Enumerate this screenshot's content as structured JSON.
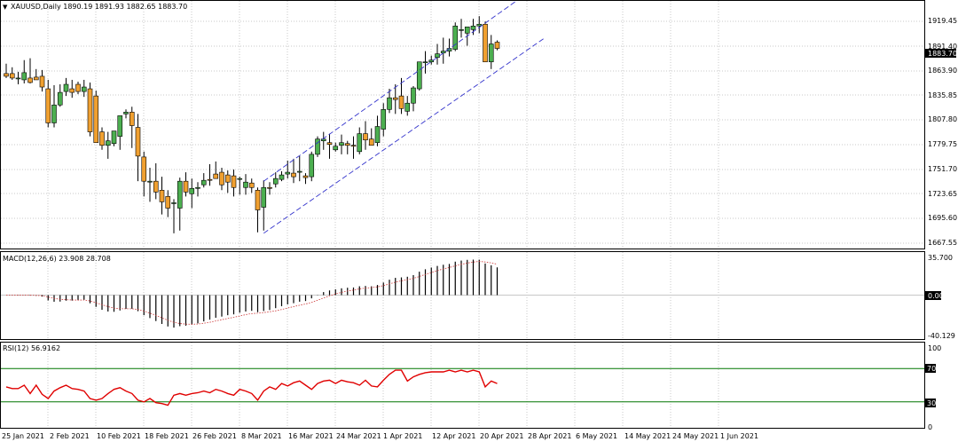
{
  "header": {
    "title": "XAUUSD,Daily  1890.19 1891.93 1882.65 1883.70"
  },
  "price_panel": {
    "y_ticks": [
      "1919.45",
      "1891.40",
      "1863.90",
      "1835.85",
      "1807.80",
      "1779.75",
      "1751.70",
      "1723.65",
      "1695.60",
      "1667.55"
    ],
    "current_label": "1883.70"
  },
  "macd_panel": {
    "label": "MACD(12,26,6) 23.908 28.708",
    "y_ticks": [
      "35.700",
      "0.00",
      "-40.129"
    ]
  },
  "rsi_panel": {
    "label": "RSI(12) 56.9162",
    "y_ticks": [
      "100",
      "70",
      "30",
      "0"
    ]
  },
  "x_axis": {
    "labels": [
      "25 Jan 2021",
      "2 Feb 2021",
      "10 Feb 2021",
      "18 Feb 2021",
      "26 Feb 2021",
      "8 Mar 2021",
      "16 Mar 2021",
      "24 Mar 2021",
      "1 Apr 2021",
      "12 Apr 2021",
      "20 Apr 2021",
      "28 Apr 2021",
      "6 May 2021",
      "14 May 2021",
      "24 May 2021",
      "1 Jun 2021"
    ]
  },
  "colors": {
    "bull": "#4caf50",
    "bear": "#f0a030",
    "channel": "#3333cc",
    "rsi_line": "#e00000",
    "rsi_level": "#007700",
    "signal": "#cc3333"
  },
  "chart_data": {
    "type": "candlestick",
    "symbol": "XAUUSD",
    "timeframe": "Daily",
    "series": {
      "open": [
        1855,
        1855,
        1850,
        1848,
        1850,
        1851,
        1852,
        1838,
        1800,
        1820,
        1835,
        1838,
        1843,
        1835,
        1838,
        1830,
        1790,
        1775,
        1777,
        1785,
        1810,
        1812,
        1795,
        1762,
        1735,
        1735,
        1725,
        1718,
        1711,
        1705,
        1735,
        1721,
        1727,
        1731,
        1737,
        1743,
        1745,
        1742,
        1741,
        1737,
        1728,
        1733,
        1725,
        1706,
        1728,
        1732,
        1737,
        1743,
        1744,
        1745,
        1741,
        1740,
        1765,
        1780,
        1778,
        1770,
        1775,
        1777,
        1775,
        1768,
        1788,
        1782,
        1778,
        1793,
        1815,
        1828,
        1830,
        1813,
        1822,
        1838,
        1868,
        1868,
        1873,
        1878,
        1880,
        1882,
        1903,
        1900,
        1904,
        1908,
        1910,
        1868,
        1890
      ],
      "high": [
        1866,
        1862,
        1857,
        1870,
        1872,
        1860,
        1859,
        1848,
        1842,
        1843,
        1850,
        1848,
        1846,
        1848,
        1845,
        1836,
        1795,
        1790,
        1788,
        1805,
        1815,
        1818,
        1810,
        1768,
        1750,
        1755,
        1740,
        1725,
        1715,
        1739,
        1745,
        1738,
        1734,
        1744,
        1754,
        1757,
        1750,
        1747,
        1748,
        1740,
        1743,
        1738,
        1728,
        1736,
        1734,
        1745,
        1746,
        1758,
        1760,
        1763,
        1744,
        1768,
        1785,
        1790,
        1788,
        1778,
        1787,
        1780,
        1785,
        1795,
        1802,
        1794,
        1808,
        1822,
        1838,
        1843,
        1850,
        1830,
        1841,
        1868,
        1880,
        1875,
        1888,
        1895,
        1894,
        1912,
        1916,
        1906,
        1916,
        1919,
        1913,
        1898,
        1892
      ],
      "low": [
        1850,
        1848,
        1843,
        1844,
        1844,
        1848,
        1835,
        1795,
        1795,
        1818,
        1830,
        1828,
        1832,
        1829,
        1785,
        1785,
        1770,
        1760,
        1774,
        1770,
        1805,
        1772,
        1735,
        1718,
        1712,
        1715,
        1698,
        1695,
        1677,
        1680,
        1718,
        1705,
        1718,
        1728,
        1730,
        1738,
        1725,
        1722,
        1718,
        1720,
        1720,
        1722,
        1678,
        1680,
        1720,
        1728,
        1735,
        1738,
        1733,
        1735,
        1732,
        1735,
        1762,
        1770,
        1760,
        1768,
        1765,
        1765,
        1760,
        1765,
        1770,
        1778,
        1774,
        1785,
        1811,
        1810,
        1810,
        1808,
        1813,
        1836,
        1855,
        1865,
        1865,
        1866,
        1874,
        1880,
        1895,
        1886,
        1898,
        1900,
        1870,
        1860,
        1881
      ],
      "close": [
        1852,
        1850,
        1850,
        1856,
        1845,
        1848,
        1840,
        1800,
        1820,
        1834,
        1843,
        1834,
        1835,
        1840,
        1790,
        1778,
        1775,
        1780,
        1791,
        1808,
        1812,
        1797,
        1763,
        1735,
        1735,
        1723,
        1712,
        1705,
        1711,
        1735,
        1723,
        1727,
        1728,
        1736,
        1736,
        1738,
        1731,
        1734,
        1728,
        1738,
        1734,
        1728,
        1703,
        1728,
        1727,
        1738,
        1742,
        1745,
        1740,
        1746,
        1739,
        1765,
        1782,
        1782,
        1776,
        1774,
        1778,
        1775,
        1774,
        1788,
        1781,
        1775,
        1796,
        1815,
        1828,
        1826,
        1816,
        1822,
        1839,
        1868,
        1868,
        1870,
        1877,
        1880,
        1883,
        1908,
        1904,
        1907,
        1908,
        1910,
        1868,
        1888,
        1883
      ]
    },
    "price_range": [
      1660,
      1935
    ],
    "channel": {
      "upper": [
        [
          43,
          1735
        ],
        [
          85,
          1935
        ]
      ],
      "lower": [
        [
          43,
          1677
        ],
        [
          90,
          1895
        ]
      ]
    },
    "macd": {
      "params": "12,26,6",
      "value": 23.908,
      "signal": 28.708,
      "range": [
        -40.129,
        35.7
      ]
    },
    "rsi": {
      "period": 12,
      "value": 56.9162,
      "levels": [
        70,
        30
      ],
      "values": [
        48,
        46,
        46,
        50,
        40,
        50,
        39,
        34,
        43,
        47,
        50,
        46,
        45,
        43,
        34,
        32,
        34,
        40,
        45,
        47,
        43,
        40,
        32,
        30,
        34,
        29,
        28,
        26,
        38,
        40,
        38,
        40,
        41,
        43,
        41,
        45,
        43,
        40,
        38,
        45,
        43,
        40,
        32,
        43,
        48,
        45,
        52,
        49,
        53,
        55,
        50,
        45,
        52,
        55,
        56,
        52,
        56,
        54,
        53,
        50,
        56,
        49,
        48,
        56,
        63,
        68,
        68,
        55,
        60,
        63,
        65,
        66,
        66,
        66,
        68,
        66,
        68,
        66,
        68,
        66,
        48,
        55,
        52
      ]
    }
  }
}
